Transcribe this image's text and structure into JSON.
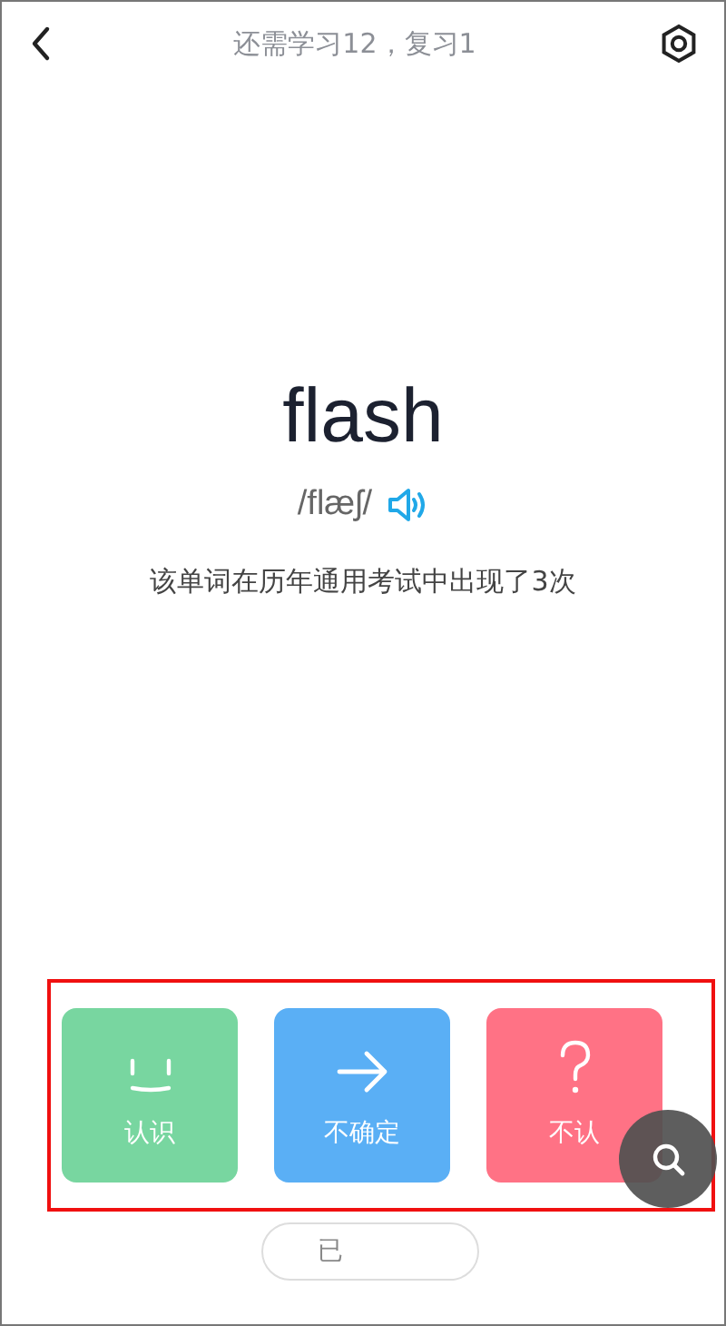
{
  "header": {
    "title": "还需学习12，复习1"
  },
  "word": {
    "text": "flash",
    "phonetic": "/flæʃ/",
    "note": "该单词在历年通用考试中出现了3次"
  },
  "choices": [
    {
      "kind": "know",
      "label": "认识",
      "color": "#78d6a0"
    },
    {
      "kind": "unsure",
      "label": "不确定",
      "color": "#5aaff5"
    },
    {
      "kind": "unknown",
      "label": "不认",
      "color": "#ff7285"
    }
  ],
  "pill": {
    "label": "已"
  }
}
